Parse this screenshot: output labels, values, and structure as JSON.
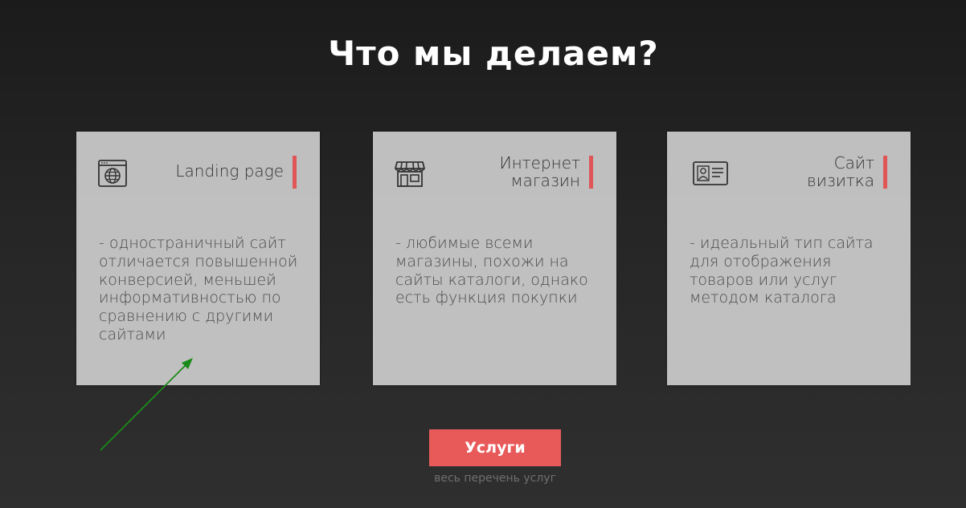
{
  "page": {
    "title": "Что мы делаем?"
  },
  "cards": [
    {
      "icon": "browser-globe-icon",
      "title_lines": [
        "Landing page"
      ],
      "description": "- одностраничный сайт отличается повышенной конверсией, меньшей информативностью по сравнению с другими сайтами"
    },
    {
      "icon": "shop-storefront-icon",
      "title_lines": [
        "Интернет",
        "магазин"
      ],
      "description": "- любимые всеми магазины, похожи на сайты каталоги, однако есть функция покупки"
    },
    {
      "icon": "id-card-icon",
      "title_lines": [
        "Сайт",
        "визитка"
      ],
      "description": "- идеальный тип сайта для отображения товаров или услуг методом каталога"
    }
  ],
  "cta": {
    "button_label": "Услуги",
    "subtitle": "весь перечень услуг"
  },
  "colors": {
    "accent": "#e85a5a",
    "card_bg": "#c0c0c0",
    "annotation_arrow": "#1a8a1a"
  }
}
